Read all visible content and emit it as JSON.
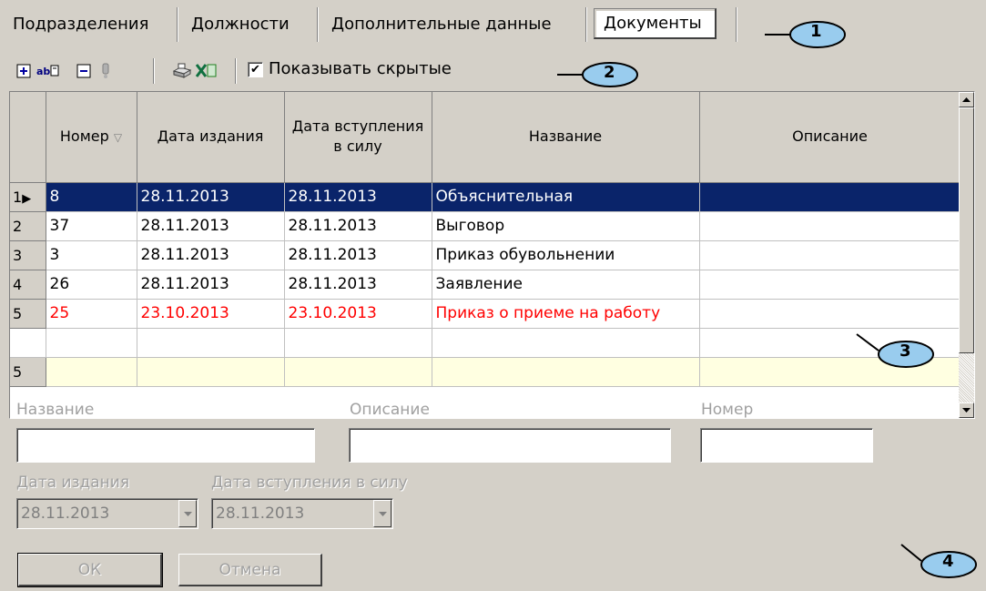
{
  "tabs": [
    {
      "label": "Подразделения"
    },
    {
      "label": "Должности"
    },
    {
      "label": "Дополнительные данные"
    },
    {
      "label": "Документы",
      "active": true
    }
  ],
  "callouts": [
    "1",
    "2",
    "3",
    "4"
  ],
  "toolbar": {
    "buttons": [
      "add-record-icon",
      "edit-text-icon",
      "delete-record-icon",
      "info-icon",
      "print-icon",
      "excel-export-icon"
    ],
    "show_hidden_checked": true,
    "show_hidden_label": "Показывать скрытые"
  },
  "grid": {
    "columns": {
      "number": "Номер",
      "issue_date": "Дата издания",
      "effective_date": "Дата вступления в силу",
      "name": "Название",
      "description": "Описание"
    },
    "rows": [
      {
        "index": "1",
        "number": "8",
        "issue_date": "28.11.2013",
        "effective_date": "28.11.2013",
        "name": "Объяснительная",
        "description": "",
        "selected": true
      },
      {
        "index": "2",
        "number": "37",
        "issue_date": "28.11.2013",
        "effective_date": "28.11.2013",
        "name": "Выговор",
        "description": ""
      },
      {
        "index": "3",
        "number": "3",
        "issue_date": "28.11.2013",
        "effective_date": "28.11.2013",
        "name": "Приказ обувольнении",
        "description": ""
      },
      {
        "index": "4",
        "number": "26",
        "issue_date": "28.11.2013",
        "effective_date": "28.11.2013",
        "name": "Заявление",
        "description": ""
      },
      {
        "index": "5",
        "number": "25",
        "issue_date": "23.10.2013",
        "effective_date": "23.10.2013",
        "name": "Приказ о приеме на работу",
        "description": "",
        "hidden_color": "#ff0000"
      }
    ],
    "summary_count": "5"
  },
  "form": {
    "name_label": "Название",
    "name_value": "",
    "description_label": "Описание",
    "description_value": "",
    "number_label": "Номер",
    "number_value": "",
    "issue_date_label": "Дата издания",
    "issue_date_value": "28.11.2013",
    "effective_date_label": "Дата вступления в силу",
    "effective_date_value": "28.11.2013",
    "ok_label": "ОК",
    "cancel_label": "Отмена"
  }
}
